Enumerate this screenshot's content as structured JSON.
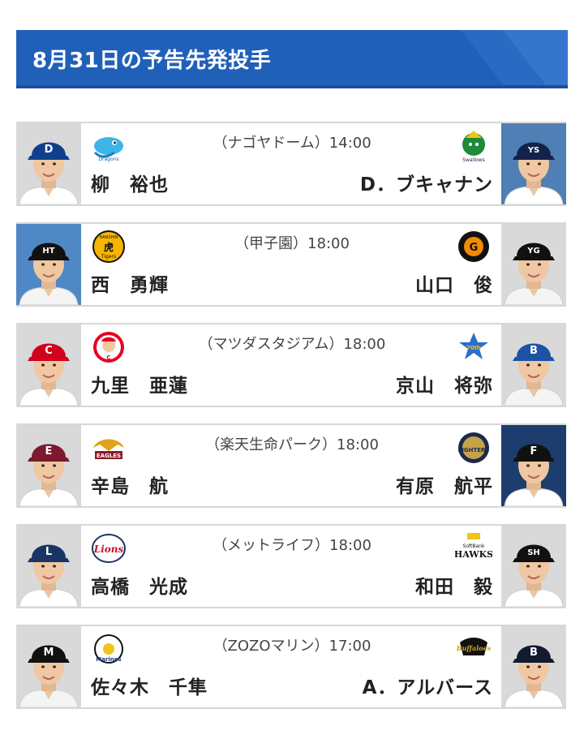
{
  "header": {
    "title": "8月31日の予告先発投手"
  },
  "colors": {
    "header_bg": "#2160b9",
    "card_border": "#d7d7d7"
  },
  "games": [
    {
      "venue": "（ナゴヤドーム）14:00",
      "home": {
        "pitcher": "柳　裕也",
        "logo": "dragons-logo",
        "cap": "#123f8c",
        "letter": "D",
        "bg": "#d9d9d9",
        "jersey": "#ffffff"
      },
      "away": {
        "pitcher": "D．ブキャナン",
        "logo": "swallows-logo",
        "cap": "#14224a",
        "letter": "YS",
        "bg": "#4f7fb4",
        "jersey": "#ffffff"
      }
    },
    {
      "venue": "（甲子園）18:00",
      "home": {
        "pitcher": "西　勇輝",
        "logo": "tigers-logo",
        "cap": "#111111",
        "letter": "HT",
        "bg": "#4f88c5",
        "jersey": "#f4f4f4"
      },
      "away": {
        "pitcher": "山口　俊",
        "logo": "giants-logo",
        "cap": "#111111",
        "letter": "YG",
        "bg": "#d9d9d9",
        "jersey": "#f4f4f4"
      }
    },
    {
      "venue": "（マツダスタジアム）18:00",
      "home": {
        "pitcher": "九里　亜蓮",
        "logo": "carp-logo",
        "cap": "#d1001f",
        "letter": "C",
        "bg": "#d9d9d9",
        "jersey": "#ffffff"
      },
      "away": {
        "pitcher": "京山　将弥",
        "logo": "baystars-logo",
        "cap": "#1d53a6",
        "letter": "B",
        "bg": "#d9d9d9",
        "jersey": "#f4f4f4"
      }
    },
    {
      "venue": "（楽天生命パーク）18:00",
      "home": {
        "pitcher": "辛島　航",
        "logo": "eagles-logo",
        "cap": "#7a1a2c",
        "letter": "E",
        "bg": "#d9d9d9",
        "jersey": "#ffffff"
      },
      "away": {
        "pitcher": "有原　航平",
        "logo": "fighters-logo",
        "cap": "#111111",
        "letter": "F",
        "bg": "#1c3d6e",
        "jersey": "#ffffff"
      }
    },
    {
      "venue": "（メットライフ）18:00",
      "home": {
        "pitcher": "高橋　光成",
        "logo": "lions-logo",
        "cap": "#1a3565",
        "letter": "L",
        "bg": "#d9d9d9",
        "jersey": "#ffffff"
      },
      "away": {
        "pitcher": "和田　毅",
        "logo": "hawks-logo",
        "cap": "#111111",
        "letter": "SH",
        "bg": "#d9d9d9",
        "jersey": "#ffffff"
      }
    },
    {
      "venue": "（ZOZOマリン）17:00",
      "home": {
        "pitcher": "佐々木　千隼",
        "logo": "marines-logo",
        "cap": "#111111",
        "letter": "M",
        "bg": "#d9d9d9",
        "jersey": "#f4f4f4"
      },
      "away": {
        "pitcher": "A．アルバース",
        "logo": "buffaloes-logo",
        "cap": "#111a2e",
        "letter": "B",
        "bg": "#d9d9d9",
        "jersey": "#ffffff"
      }
    }
  ]
}
